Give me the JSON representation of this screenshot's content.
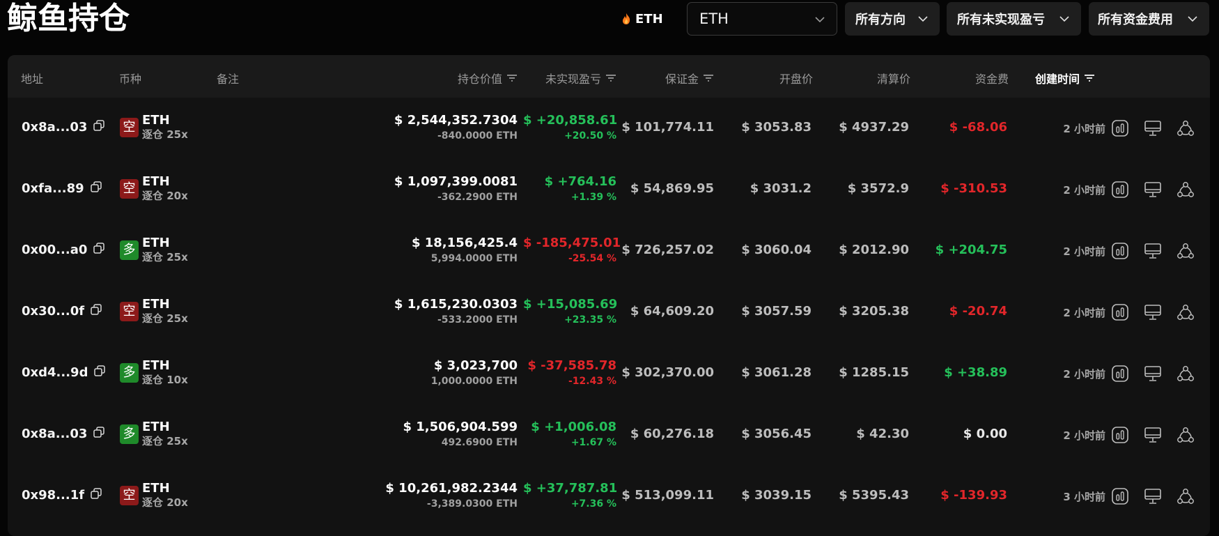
{
  "page": {
    "title": "鲸鱼持仓"
  },
  "hot_symbol": {
    "label": "ETH",
    "icon": "flame-icon"
  },
  "filters": {
    "symbol": "ETH",
    "direction": "所有方向",
    "unrealized_pnl": "所有未实现盈亏",
    "funding_fee": "所有资金费用"
  },
  "table": {
    "headers": {
      "address": "地址",
      "coin": "币种",
      "note": "备注",
      "position_value": "持仓价值",
      "unrealized_pnl": "未实现盈亏",
      "margin": "保证金",
      "open_price": "开盘价",
      "liq_price": "清算价",
      "funding_fee": "资金费",
      "created_time": "创建时间"
    },
    "rows": [
      {
        "address": "0x8a...03",
        "side": "空",
        "side_type": "short",
        "coin": "ETH",
        "leverage": "逐仓 25x",
        "value": "$ 2,544,352.7304",
        "size": "-840.0000 ETH",
        "pnl": "$ +20,858.61",
        "pnl_pct": "+20.50 %",
        "pnl_dir": "green",
        "margin": "$ 101,774.11",
        "open": "$ 3053.83",
        "liq": "$ 4937.29",
        "fund": "$ -68.06",
        "fund_dir": "red",
        "time": "2 小时前"
      },
      {
        "address": "0xfa...89",
        "side": "空",
        "side_type": "short",
        "coin": "ETH",
        "leverage": "逐仓 20x",
        "value": "$ 1,097,399.0081",
        "size": "-362.2900 ETH",
        "pnl": "$ +764.16",
        "pnl_pct": "+1.39 %",
        "pnl_dir": "green",
        "margin": "$ 54,869.95",
        "open": "$ 3031.2",
        "liq": "$ 3572.9",
        "fund": "$ -310.53",
        "fund_dir": "red",
        "time": "2 小时前"
      },
      {
        "address": "0x00...a0",
        "side": "多",
        "side_type": "long",
        "coin": "ETH",
        "leverage": "逐仓 25x",
        "value": "$ 18,156,425.4",
        "size": "5,994.0000 ETH",
        "pnl": "$ -185,475.01",
        "pnl_pct": "-25.54 %",
        "pnl_dir": "red",
        "margin": "$ 726,257.02",
        "open": "$ 3060.04",
        "liq": "$ 2012.90",
        "fund": "$ +204.75",
        "fund_dir": "green",
        "time": "2 小时前"
      },
      {
        "address": "0x30...0f",
        "side": "空",
        "side_type": "short",
        "coin": "ETH",
        "leverage": "逐仓 25x",
        "value": "$ 1,615,230.0303",
        "size": "-533.2000 ETH",
        "pnl": "$ +15,085.69",
        "pnl_pct": "+23.35 %",
        "pnl_dir": "green",
        "margin": "$ 64,609.20",
        "open": "$ 3057.59",
        "liq": "$ 3205.38",
        "fund": "$ -20.74",
        "fund_dir": "red",
        "time": "2 小时前"
      },
      {
        "address": "0xd4...9d",
        "side": "多",
        "side_type": "long",
        "coin": "ETH",
        "leverage": "逐仓 10x",
        "value": "$ 3,023,700",
        "size": "1,000.0000 ETH",
        "pnl": "$ -37,585.78",
        "pnl_pct": "-12.43 %",
        "pnl_dir": "red",
        "margin": "$ 302,370.00",
        "open": "$ 3061.28",
        "liq": "$ 1285.15",
        "fund": "$ +38.89",
        "fund_dir": "green",
        "time": "2 小时前"
      },
      {
        "address": "0x8a...03",
        "side": "多",
        "side_type": "long",
        "coin": "ETH",
        "leverage": "逐仓 25x",
        "value": "$ 1,506,904.599",
        "size": "492.6900 ETH",
        "pnl": "$ +1,006.08",
        "pnl_pct": "+1.67 %",
        "pnl_dir": "green",
        "margin": "$ 60,276.18",
        "open": "$ 3056.45",
        "liq": "$ 42.30",
        "fund": "$ 0.00",
        "fund_dir": "neutral",
        "time": "2 小时前"
      },
      {
        "address": "0x98...1f",
        "side": "空",
        "side_type": "short",
        "coin": "ETH",
        "leverage": "逐仓 20x",
        "value": "$ 10,261,982.2344",
        "size": "-3,389.0300 ETH",
        "pnl": "$ +37,787.81",
        "pnl_pct": "+7.36 %",
        "pnl_dir": "green",
        "margin": "$ 513,099.11",
        "open": "$ 3039.15",
        "liq": "$ 5395.43",
        "fund": "$ -139.93",
        "fund_dir": "red",
        "time": "3 小时前"
      }
    ]
  },
  "colors": {
    "positive": "#25c05a",
    "negative": "#e2262a",
    "short_badge": "#8c1a1a",
    "long_badge": "#1f8a2a",
    "background": "#050505",
    "table": "#121212"
  }
}
